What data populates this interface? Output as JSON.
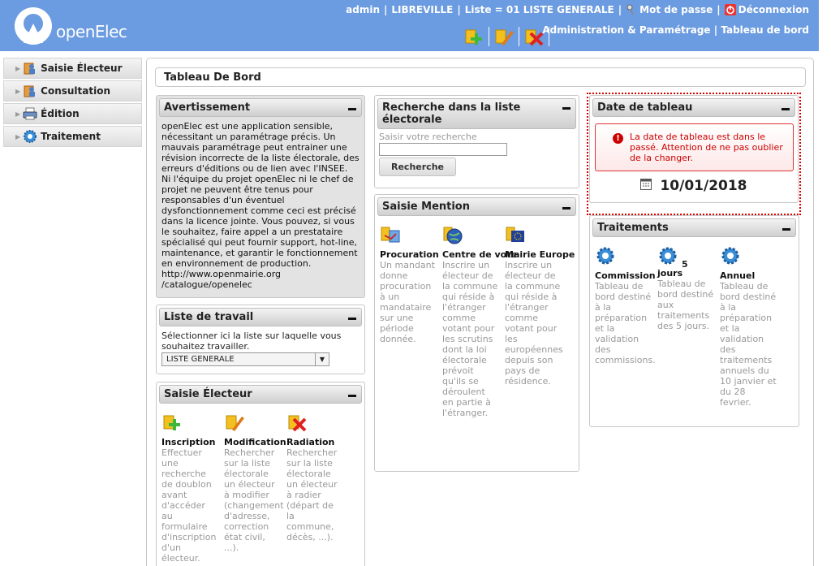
{
  "header": {
    "app_name": "openElec",
    "user": "admin",
    "city": "LIBREVILLE",
    "list": "Liste = 01 LISTE GENERALE",
    "password": "Mot de passe",
    "logout": "Déconnexion",
    "admin": "Administration & Paramétrage",
    "dashboard": "Tableau de bord",
    "separator": "|"
  },
  "menu": [
    {
      "label": "Saisie Électeur",
      "icon": "people-icon"
    },
    {
      "label": "Consultation",
      "icon": "people-icon"
    },
    {
      "label": "Édition",
      "icon": "printer-icon"
    },
    {
      "label": "Traitement",
      "icon": "gears-icon"
    }
  ],
  "page_title": "Tableau De Bord",
  "avertissement": {
    "title": "Avertissement",
    "text": "openElec est une application sensible, nécessitant un paramétrage précis. Un mauvais paramétrage peut entrainer une révision incorrecte de la liste électorale, des erreurs d'éditions ou de lien avec l'INSEE. Ni l'équipe du projet openElec ni le chef de projet ne peuvent être tenus pour responsables d'un éventuel dysfonctionnement comme ceci est précisé dans la licence jointe. Vous pouvez, si vous le souhaitez, faire appel a un prestataire spécialisé qui peut fournir support, hot-line, maintenance, et garantir le fonctionnement en environnement de production. http://www.openmairie.org /catalogue/openelec"
  },
  "liste_travail": {
    "title": "Liste de travail",
    "text": "Sélectionner ici la liste sur laquelle vous souhaitez travailler.",
    "selected": "LISTE GENERALE"
  },
  "saisie_electeur": {
    "title": "Saisie Électeur",
    "items": [
      {
        "name": "Inscription",
        "desc": "Effectuer une recherche de doublon avant d'accéder au formulaire d'inscription d'un électeur."
      },
      {
        "name": "Modification",
        "desc": "Rechercher sur la liste électorale un électeur à modifier (changement d'adresse, correction état civil, ...)."
      },
      {
        "name": "Radiation",
        "desc": "Rechercher sur la liste électorale un électeur à radier (départ de la commune, décès, ...)."
      }
    ]
  },
  "recherche": {
    "title": "Recherche dans la liste électorale",
    "label": "Saisir votre recherche",
    "value": "",
    "button": "Recherche"
  },
  "mention": {
    "title": "Saisie Mention",
    "items": [
      {
        "name": "Procuration",
        "desc": "Un mandant donne procuration à un mandataire sur une période donnée."
      },
      {
        "name": "Centre de vote",
        "desc": "Inscrire un électeur de la commune qui réside à l'étranger comme votant pour les scrutins dont la loi électorale prévoit qu'ils se déroulent en partie à l'étranger."
      },
      {
        "name": "Mairie Europe",
        "desc": "Inscrire un électeur de la commune qui réside à l'étranger comme votant pour les européennes depuis son pays de résidence."
      }
    ]
  },
  "date_tableau": {
    "title": "Date de tableau",
    "alert": "La date de tableau est dans le passé. Attention de ne pas oublier de la changer.",
    "date": "10/01/2018"
  },
  "traitements": {
    "title": "Traitements",
    "items": [
      {
        "name": "Commission",
        "extra": "",
        "desc": "Tableau de bord destiné à la préparation et la validation des commissions."
      },
      {
        "name": "jours",
        "extra": "5",
        "desc": "Tableau de bord destiné aux traitements des 5 jours."
      },
      {
        "name": "Annuel",
        "extra": "",
        "desc": "Tableau de bord destiné à la préparation et la validation des traitements annuels du 10 janvier et du 28 fevrier."
      }
    ]
  }
}
